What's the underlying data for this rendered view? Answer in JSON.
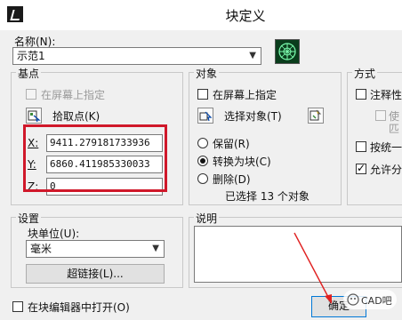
{
  "window": {
    "title": "块定义"
  },
  "name_field": {
    "label": "名称(N):",
    "value": "示范1"
  },
  "basepoint": {
    "title": "基点",
    "specify_on_screen": "在屏幕上指定",
    "pick_point": "拾取点(K)",
    "x_label": "X:",
    "x_value": "9411.279181733936",
    "y_label": "Y:",
    "y_value": "6860.411985330033",
    "z_label": "Z:",
    "z_value": "0"
  },
  "objects": {
    "title": "对象",
    "specify_on_screen": "在屏幕上指定",
    "select_objects": "选择对象(T)",
    "retain": "保留(R)",
    "convert_to_block": "转换为块(C)",
    "delete": "删除(D)",
    "status": "已选择 13 个对象"
  },
  "behavior": {
    "title": "方式",
    "annotative": "注释性",
    "match_orientation_line1": "使",
    "match_orientation_line2": "匹",
    "scale_uniformly": "按统一",
    "allow_exploding": "允许分"
  },
  "settings": {
    "title": "设置",
    "block_unit_label": "块单位(U):",
    "block_unit_value": "毫米",
    "hyperlink_button": "超链接(L)..."
  },
  "description": {
    "title": "说明"
  },
  "footer": {
    "open_in_editor": "在块编辑器中打开(O)",
    "ok_button": "确定",
    "watermark": "CAD吧"
  },
  "colors": {
    "highlight_border": "#d0182a",
    "annotation_arrow": "#e02020",
    "preview_bg": "#0a3d1c"
  }
}
